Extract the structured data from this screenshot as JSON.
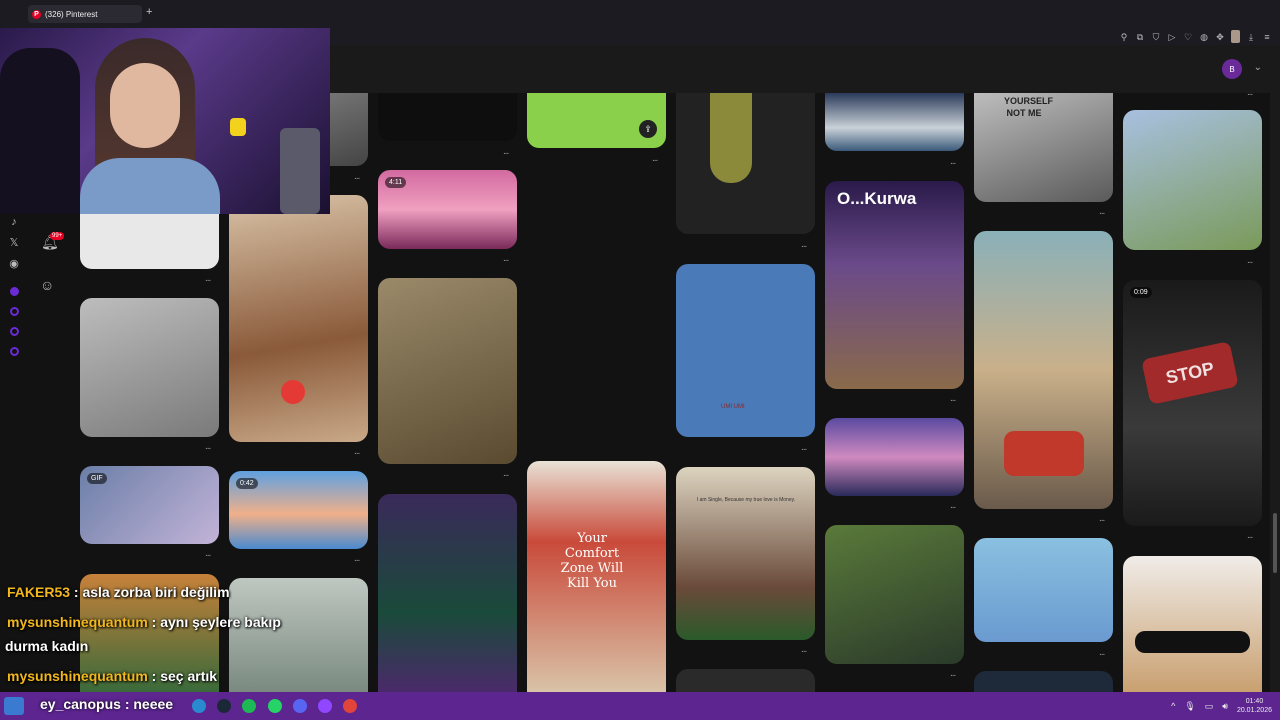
{
  "browser": {
    "tab_title": "(326) Pinterest",
    "tab_favicon": "P",
    "new_tab": "+",
    "toolbar_icons": [
      "pin-icon",
      "crop-icon",
      "shield-icon",
      "play-icon",
      "heart-icon",
      "gamepad-icon",
      "puzzle-icon",
      "profile-icon",
      "download-icon",
      "menu-icon"
    ]
  },
  "header": {
    "account_initial": "B",
    "chevron": "⌄"
  },
  "sidebar": {
    "notification_count": "99+"
  },
  "pins": [
    {
      "badge": "4:11"
    },
    {
      "badge": "GIF"
    },
    {
      "badge": "0:42"
    },
    {
      "badge": "0:09"
    },
    {
      "caption": "O...Kurwa"
    },
    {
      "caption": "YOURSELF NOT ME"
    },
    {
      "caption": "STOP"
    },
    {
      "caption": "Your Comfort Zone Will Kill You"
    },
    {
      "caption": "I am Single, Because my true love is Money."
    },
    {
      "caption": "UMI UMI"
    }
  ],
  "more": "...",
  "chat": [
    {
      "user": "FAKER53",
      "message": " : asla zorba biri değilim"
    },
    {
      "user": "mysunshinequantum",
      "message": " : aynı şeylere bakıp"
    },
    {
      "user": "",
      "message": "durma kadın"
    },
    {
      "user": "mysunshinequantum",
      "message": " : seç artık"
    },
    {
      "user": "ey_canopus",
      "message": " : neeee"
    }
  ],
  "taskbar": {
    "time": "01:40",
    "date": "20.01.2026",
    "tray_up": "^"
  },
  "colors": {
    "taskbar": "#5c2590",
    "chat_user": "#f2b71d",
    "pinterest_red": "#e60023"
  }
}
